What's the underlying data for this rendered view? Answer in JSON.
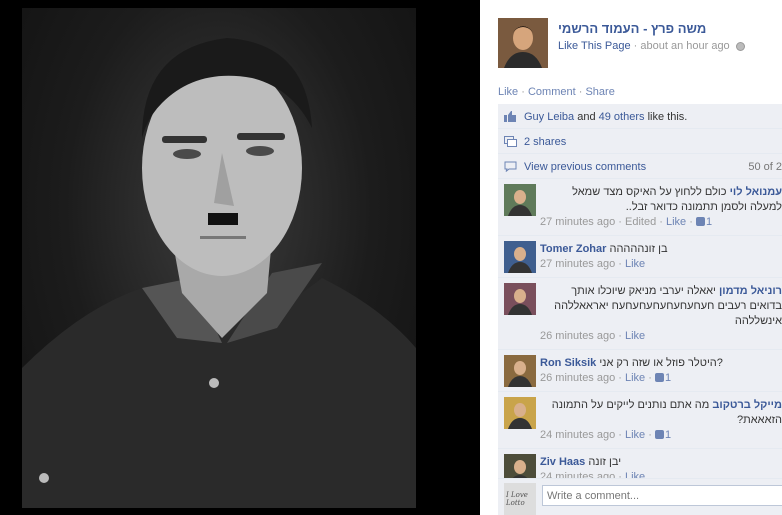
{
  "post": {
    "page_name": "משה פרץ - העמוד הרשמי",
    "like_page": "Like This Page",
    "time": "about an hour ago",
    "separator": "·"
  },
  "actions": {
    "like": "Like",
    "comment": "Comment",
    "share": "Share",
    "dot": "·"
  },
  "likes": {
    "user": "Guy Leiba",
    "and": "and",
    "others": "49 others",
    "tail": "like this."
  },
  "shares": {
    "label": "2 shares"
  },
  "previous": {
    "label": "View previous comments",
    "count": "50 of 2"
  },
  "comments": [
    {
      "author": "עמנואל לוי",
      "text": "כולם ללחוץ על האיקס מצד שמאל למעלה ולסמן תתמונה כדואר זבל..",
      "time": "27 minutes ago",
      "edited": "Edited",
      "like": "Like",
      "likes": "1",
      "dir": "rtl",
      "avatar_color": "#5f7a5a"
    },
    {
      "author": "Tomer Zohar",
      "text": "בן זונההההה",
      "time": "27 minutes ago",
      "edited": "",
      "like": "Like",
      "likes": "",
      "dir": "ltr",
      "avatar_color": "#3f5f8f"
    },
    {
      "author": "רוניאל מדמון",
      "text": "יאאלה יערבי מניאק שיוכלו אותך בדואים רעבים חעחעחעחעחעחעחעח יאראאללהה אינשללהה",
      "time": "26 minutes ago",
      "edited": "",
      "like": "Like",
      "likes": "",
      "dir": "rtl",
      "avatar_color": "#7a4f5c"
    },
    {
      "author": "Ron Siksik",
      "text": "היטלר פוזל או שזה רק אני?",
      "time": "26 minutes ago",
      "edited": "",
      "like": "Like",
      "likes": "1",
      "dir": "ltr",
      "avatar_color": "#8a6a3f"
    },
    {
      "author": "מייקל ברטקוב",
      "text": "מה אתם נותנים לייקים על התמונה הזאאאת?",
      "time": "24 minutes ago",
      "edited": "",
      "like": "Like",
      "likes": "1",
      "dir": "rtl",
      "avatar_color": "#c9a44a"
    },
    {
      "author": "Ziv Haas",
      "text": "יבן זונה",
      "time": "24 minutes ago",
      "edited": "",
      "like": "Like",
      "likes": "",
      "dir": "ltr",
      "avatar_color": "#4d4d3a"
    }
  ],
  "composer": {
    "placeholder": "Write a comment...",
    "avatar_text": "I Love Lotto"
  },
  "colors": {
    "link": "#3b5998",
    "muted": "#999999",
    "ufi_bg": "#edeff4"
  }
}
